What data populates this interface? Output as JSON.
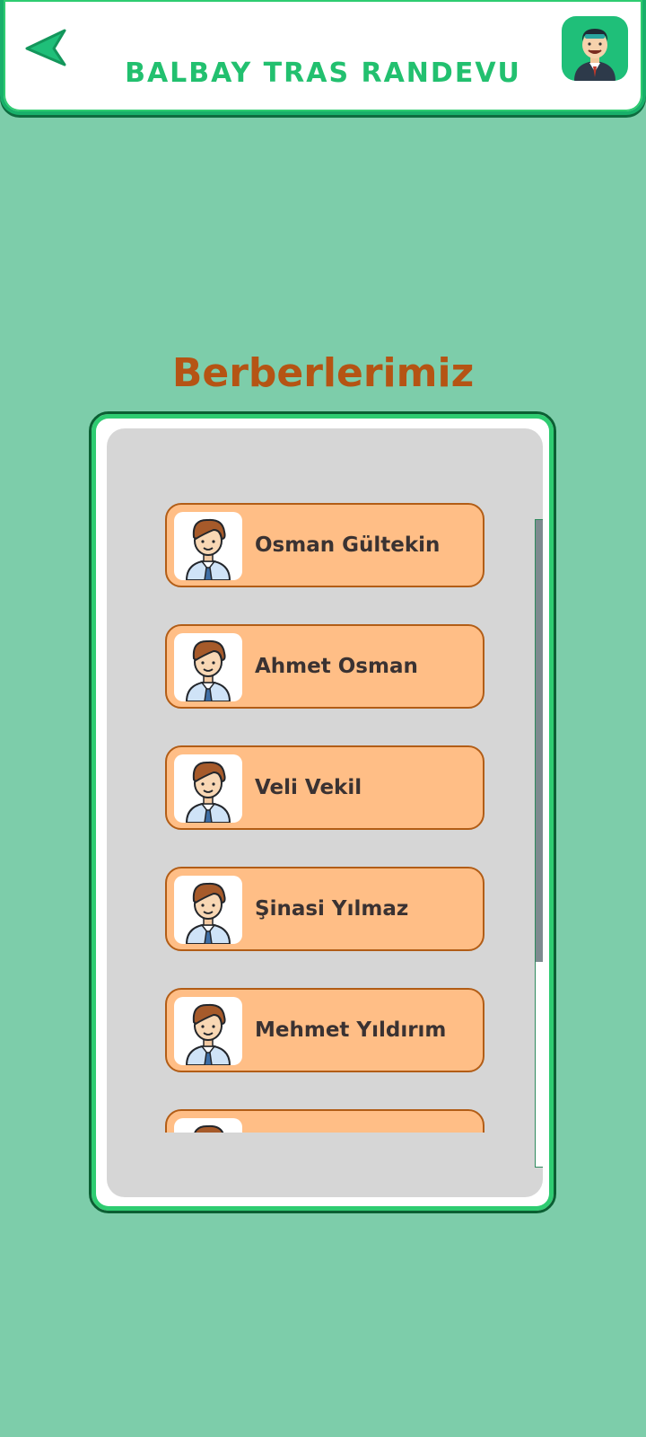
{
  "header": {
    "title": "BALBAY TRAS RANDEVU",
    "back_icon": "back-arrow-icon",
    "profile_icon": "barber-avatar-icon",
    "accent_color": "#22c06f"
  },
  "section": {
    "title": "Berberlerimiz",
    "title_color": "#b55414"
  },
  "barbers": [
    {
      "name": "Osman Gültekin",
      "icon": "barber-avatar-icon"
    },
    {
      "name": "Ahmet Osman",
      "icon": "barber-avatar-icon"
    },
    {
      "name": "Veli Vekil",
      "icon": "barber-avatar-icon"
    },
    {
      "name": "Şinasi Yılmaz",
      "icon": "barber-avatar-icon"
    },
    {
      "name": "Mehmet Yıldırım",
      "icon": "barber-avatar-icon"
    },
    {
      "name": "",
      "icon": "barber-avatar-icon"
    }
  ],
  "colors": {
    "background": "#7dcdaa",
    "card": "#ffbe86",
    "card_border": "#b25d16",
    "panel_inner": "#d6d6d6"
  }
}
